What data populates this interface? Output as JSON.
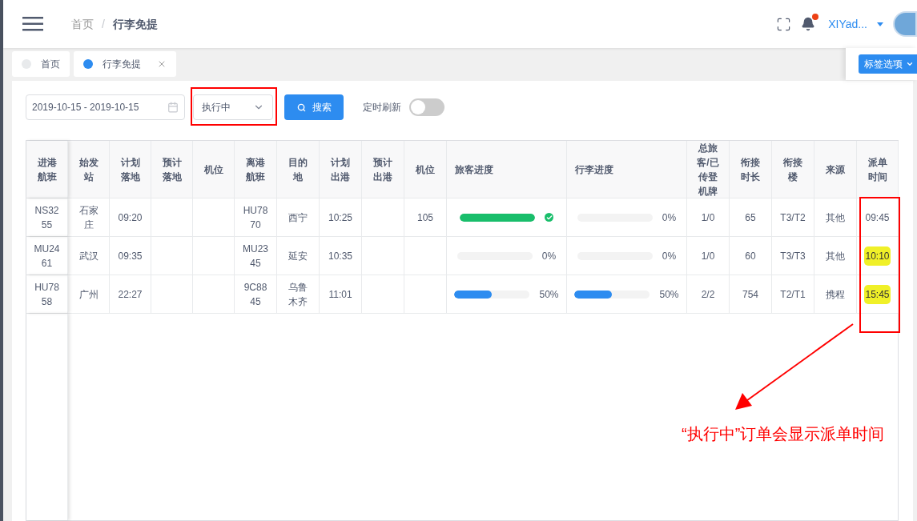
{
  "header": {
    "breadcrumb": [
      "首页",
      "行李免提"
    ],
    "separator": "/",
    "user": "XIYad...",
    "notification_dot": true
  },
  "tabs": [
    {
      "label": "首页",
      "selected": false,
      "closable": false
    },
    {
      "label": "行李免提",
      "selected": true,
      "closable": true
    }
  ],
  "tab_options": "标签选项",
  "toolbar": {
    "date_range": "2019-10-15 - 2019-10-15",
    "status": "执行中",
    "search": "搜索",
    "auto_refresh": {
      "label": "定时刷新",
      "on": false
    }
  },
  "table": {
    "columns": [
      "进港航班",
      "始发站",
      "计划落地",
      "预计落地",
      "机位",
      "离港航班",
      "目的地",
      "计划出港",
      "预计出港",
      "机位",
      "旅客进度",
      "行李进度",
      "总旅客/已传登机牌",
      "衔接时长",
      "衔接楼",
      "来源",
      "派单时间"
    ],
    "rows": [
      {
        "inbound_flight": "NS3255",
        "origin": "石家庄",
        "scheduled_landing": "09:20",
        "outbound_flight": "HU7870",
        "destination": "西宁",
        "scheduled_departure": "10:25",
        "departure_stand": "105",
        "passenger": {
          "level": 1
        },
        "baggage": {
          "level": 0,
          "label": "0%"
        },
        "passengers_boarding": "1/0",
        "connection_time": "65",
        "connection_terminal": "T3/T2",
        "source": "其他",
        "dispatch_time": {
          "text": "09:45",
          "highlighted": false
        }
      },
      {
        "inbound_flight": "MU2461",
        "origin": "武汉",
        "scheduled_landing": "09:35",
        "outbound_flight": "MU2345",
        "destination": "延安",
        "scheduled_departure": "10:35",
        "passenger": {
          "level": 0,
          "label": "0%"
        },
        "baggage": {
          "level": 0,
          "label": "0%"
        },
        "passengers_boarding": "1/0",
        "connection_time": "60",
        "connection_terminal": "T3/T3",
        "source": "其他",
        "dispatch_time": {
          "text": "10:10",
          "highlighted": true
        }
      },
      {
        "inbound_flight": "HU7858",
        "origin": "广州",
        "scheduled_landing": "22:27",
        "outbound_flight": "9C8845",
        "destination": "乌鲁木齐",
        "scheduled_departure": "11:01",
        "passenger": {
          "level": 0.5,
          "label": "50%"
        },
        "baggage": {
          "level": 0.5,
          "label": "50%"
        },
        "passengers_boarding": "2/2",
        "connection_time": "754",
        "connection_terminal": "T2/T1",
        "source": "携程",
        "dispatch_time": {
          "text": "15:45",
          "highlighted": true
        }
      }
    ]
  },
  "annotation": {
    "text": "“执行中”订单会显示派单时间"
  }
}
